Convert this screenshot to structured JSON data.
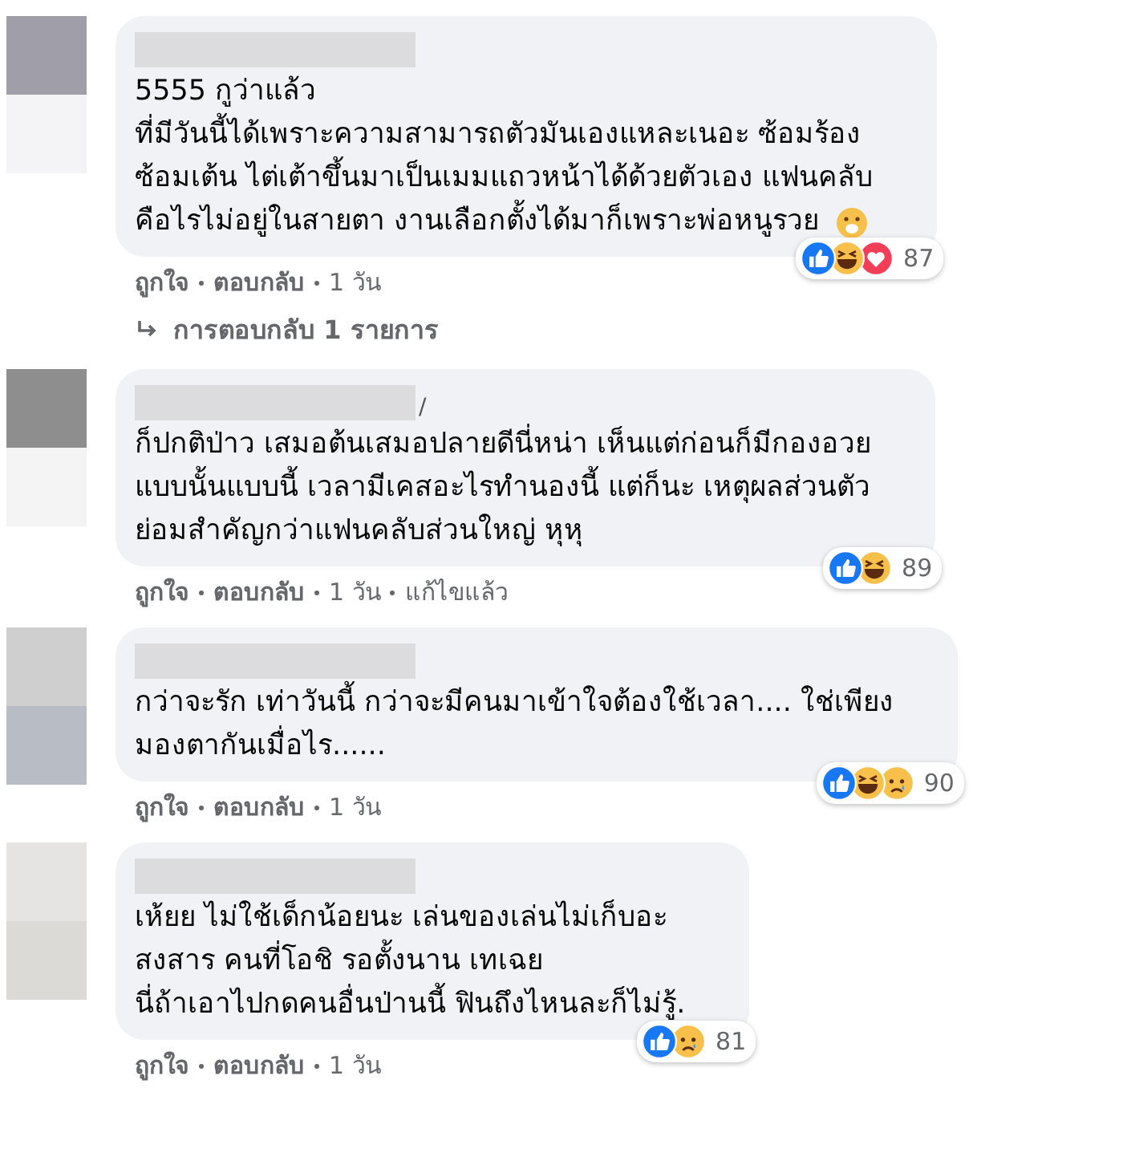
{
  "comments": [
    {
      "lines": [
        "5555 กูว่าแล้ว",
        "ที่มีวันนี้ได้เพราะความสามารถตัวมันเองแหละเนอะ ซ้อมร้อง",
        "ซ้อมเต้น ไต่เต้าขึ้นมาเป็นเมมแถวหน้าได้ด้วยตัวเอง แฟนคลับ",
        "คือไรไม่อยู่ในสายตา งานเลือกตั้งได้มาก็เพราะพ่อหนูรวย"
      ],
      "end_emoji": {
        "kind": "surprised"
      },
      "reactions": [
        {
          "kind": "like"
        },
        {
          "kind": "haha"
        },
        {
          "kind": "love"
        }
      ],
      "reaction_count": "87",
      "actions": [
        "ถูกใจ",
        "ตอบกลับ",
        "1 วัน"
      ],
      "reply_link": "การตอบกลับ 1 รายการ"
    },
    {
      "name_tail": "/",
      "lines": [
        "ก็ปกติป่าว เสมอต้นเสมอปลายดีนี่หน่า เห็นแต่ก่อนก็มีกองอวย",
        "แบบนั้นแบบนี้ เวลามีเคสอะไรทำนองนี้ แต่ก็นะ เหตุผลส่วนตัว",
        "ย่อมสำคัญกว่าแฟนคลับส่วนใหญ่ หุหุ"
      ],
      "reactions": [
        {
          "kind": "like"
        },
        {
          "kind": "haha"
        }
      ],
      "reaction_count": "89",
      "actions": [
        "ถูกใจ",
        "ตอบกลับ",
        "1 วัน",
        "แก้ไขแล้ว"
      ]
    },
    {
      "lines": [
        "กว่าจะรัก เท่าวันนี้ กว่าจะมีคนมาเข้าใจต้องใช้เวลา.... ใช่เพียง",
        "มองตากันเมื่อไร......"
      ],
      "reactions": [
        {
          "kind": "like"
        },
        {
          "kind": "haha"
        },
        {
          "kind": "sad"
        }
      ],
      "reaction_count": "90",
      "actions": [
        "ถูกใจ",
        "ตอบกลับ",
        "1 วัน"
      ]
    },
    {
      "lines": [
        "เห้ยย ไม่ใช้เด็กน้อยนะ เล่นของเล่นไม่เก็บอะ",
        "สงสาร คนที่โอชิ รอตั้งนาน เทเฉย",
        "นี่ถ้าเอาไปกดคนอื่นป่านนี้ ฟินถึงไหนละก็ไม่รู้."
      ],
      "reactions": [
        {
          "kind": "like"
        },
        {
          "kind": "sad"
        }
      ],
      "reaction_count": "81",
      "actions": [
        "ถูกใจ",
        "ตอบกลับ",
        "1 วัน"
      ]
    }
  ]
}
